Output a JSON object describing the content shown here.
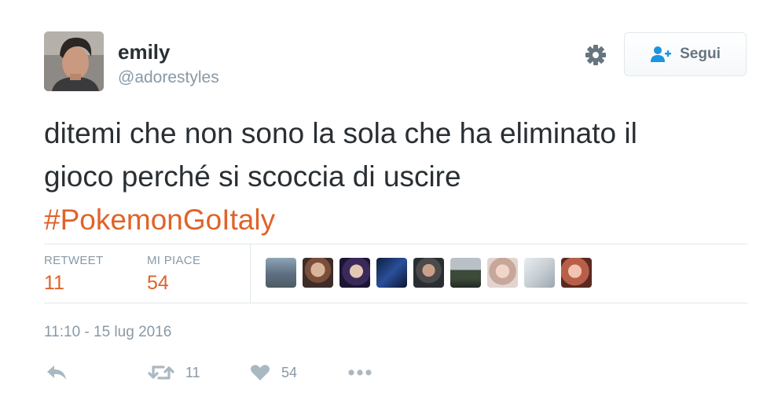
{
  "user": {
    "display_name": "emily",
    "handle": "@adorestyles",
    "avatar_icon": "profile-photo"
  },
  "header": {
    "settings_icon": "gear-icon",
    "follow_label": "Segui",
    "follow_icon": "add-user-icon"
  },
  "tweet": {
    "text_line1": "ditemi che non sono la sola che ha eliminato il",
    "text_line2": "gioco perché si scoccia di uscire",
    "hashtag": "#PokemonGoItaly",
    "hashtag_color": "#e0632a"
  },
  "stats": {
    "retweet_label": "RETWEET",
    "retweet_count": "11",
    "likes_label": "MI PIACE",
    "likes_count": "54",
    "accent_color": "#e0632a"
  },
  "likers": [
    {
      "name": "liker-avatar-1"
    },
    {
      "name": "liker-avatar-2"
    },
    {
      "name": "liker-avatar-3"
    },
    {
      "name": "liker-avatar-4"
    },
    {
      "name": "liker-avatar-5"
    },
    {
      "name": "liker-avatar-6"
    },
    {
      "name": "liker-avatar-7"
    },
    {
      "name": "liker-avatar-8"
    },
    {
      "name": "liker-avatar-9"
    }
  ],
  "timestamp": "11:10 - 15 lug 2016",
  "actions": {
    "reply_icon": "reply-icon",
    "retweet_icon": "retweet-icon",
    "retweet_count": "11",
    "like_icon": "heart-icon",
    "like_count": "54",
    "more_icon": "more-icon"
  }
}
